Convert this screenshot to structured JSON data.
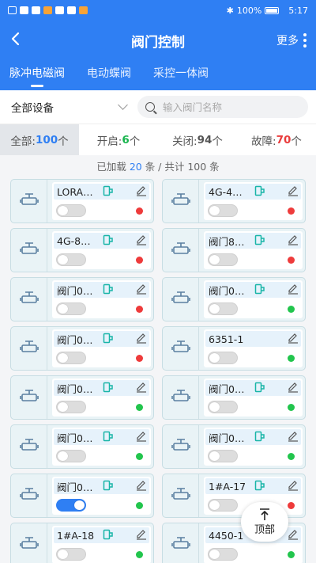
{
  "status_bar": {
    "battery": "100%",
    "time": "5:17"
  },
  "appbar": {
    "title": "阀门控制",
    "more_label": "更多"
  },
  "tabs": [
    {
      "label": "脉冲电磁阀",
      "active": true
    },
    {
      "label": "电动蝶阀",
      "active": false
    },
    {
      "label": "采控一体阀",
      "active": false
    }
  ],
  "filter": {
    "device_label": "全部设备",
    "search_placeholder": "输入阀门名称"
  },
  "stats": [
    {
      "label": "全部:",
      "value": "100",
      "unit": "个",
      "color": "#2f7ff3"
    },
    {
      "label": "开启:",
      "value": "6",
      "unit": "个",
      "color": "#19b54e"
    },
    {
      "label": "关闭:",
      "value": "94",
      "unit": "个",
      "color": "#555555"
    },
    {
      "label": "故障:",
      "value": "70",
      "unit": "个",
      "color": "#e93c3c"
    }
  ],
  "loaded": {
    "prefix": "已加载",
    "count": "20",
    "mid": "条 / 共计 100 条"
  },
  "valves": [
    {
      "name": "LORA…",
      "show_tag": true,
      "on": false,
      "status": "red"
    },
    {
      "name": "4G-4…",
      "show_tag": true,
      "on": false,
      "status": "red"
    },
    {
      "name": "4G-8…",
      "show_tag": true,
      "on": false,
      "status": "red"
    },
    {
      "name": "阀门8…",
      "show_tag": true,
      "on": false,
      "status": "red"
    },
    {
      "name": "阀门0…",
      "show_tag": true,
      "on": false,
      "status": "red"
    },
    {
      "name": "阀门0…",
      "show_tag": true,
      "on": false,
      "status": "green"
    },
    {
      "name": "阀门0…",
      "show_tag": true,
      "on": false,
      "status": "red"
    },
    {
      "name": "6351-1",
      "show_tag": false,
      "on": false,
      "status": "green"
    },
    {
      "name": "阀门0…",
      "show_tag": true,
      "on": false,
      "status": "green"
    },
    {
      "name": "阀门0…",
      "show_tag": true,
      "on": false,
      "status": "green"
    },
    {
      "name": "阀门0…",
      "show_tag": true,
      "on": false,
      "status": "green"
    },
    {
      "name": "阀门0…",
      "show_tag": true,
      "on": false,
      "status": "green"
    },
    {
      "name": "阀门0…",
      "show_tag": true,
      "on": true,
      "status": "green"
    },
    {
      "name": "1#A-17",
      "show_tag": true,
      "on": false,
      "status": "red"
    },
    {
      "name": "1#A-18",
      "show_tag": true,
      "on": false,
      "status": "green"
    },
    {
      "name": "4450-1",
      "show_tag": true,
      "on": false,
      "status": "green"
    }
  ],
  "to_top": {
    "label": "顶部"
  }
}
